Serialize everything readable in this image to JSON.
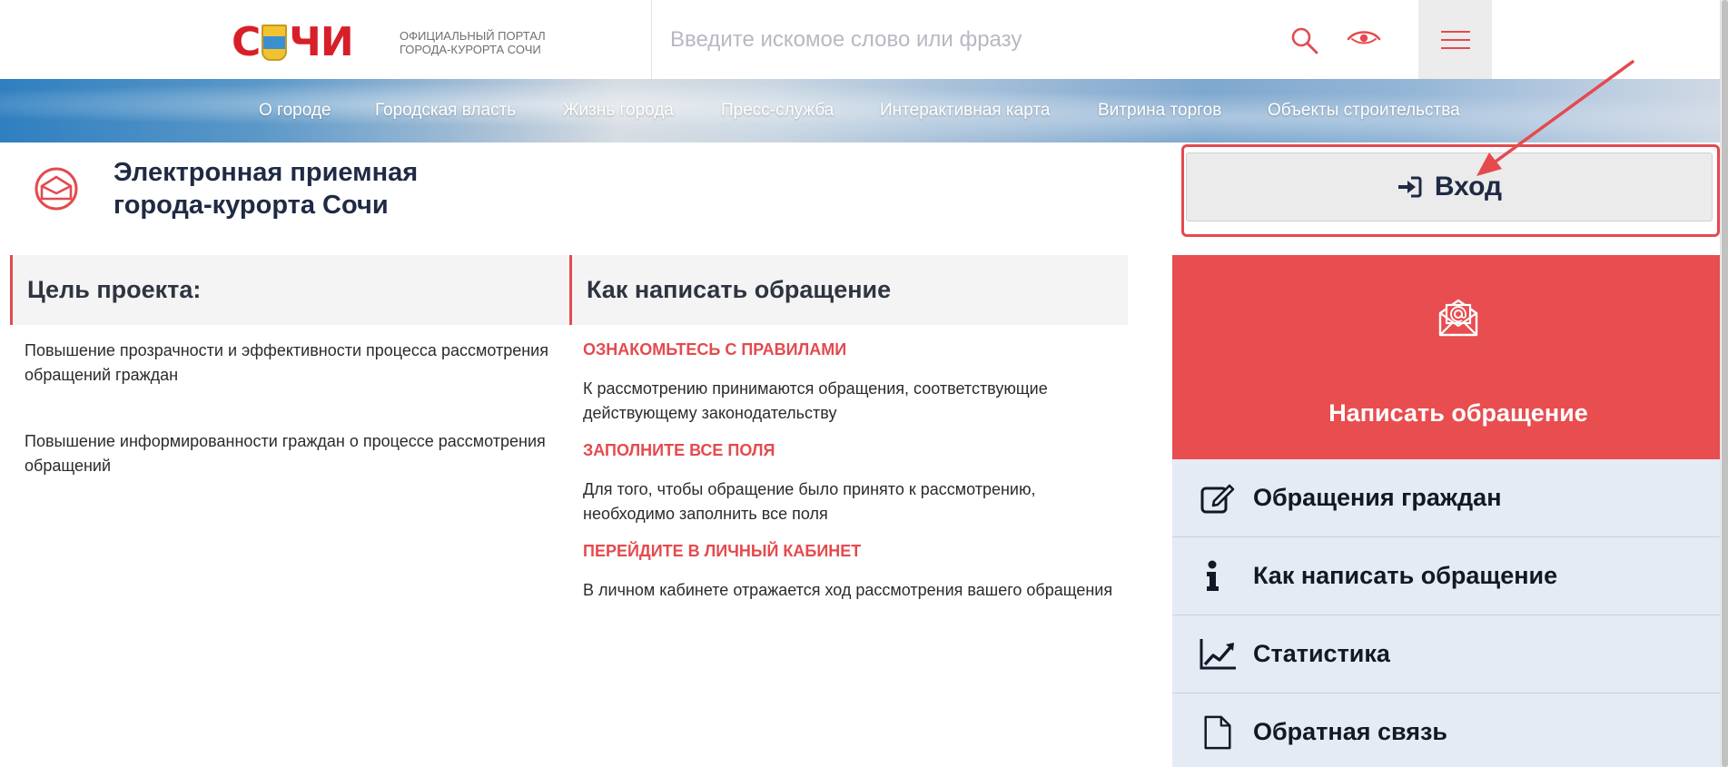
{
  "header": {
    "logo_text_left": "С",
    "logo_text_right": "ЧИ",
    "portal_caption_line1": "ОФИЦИАЛЬНЫЙ ПОРТАЛ",
    "portal_caption_line2": "ГОРОДА-КУРОРТА СОЧИ",
    "search_placeholder": "Введите искомое слово или фразу",
    "icons": [
      "search-icon",
      "eye-icon",
      "hamburger-menu-icon"
    ]
  },
  "nav": {
    "items": [
      {
        "label": "О городе"
      },
      {
        "label": "Городская власть"
      },
      {
        "label": "Жизнь города"
      },
      {
        "label": "Пресс-служба"
      },
      {
        "label": "Интерактивная карта"
      },
      {
        "label": "Витрина торгов"
      },
      {
        "label": "Объекты строительства"
      }
    ]
  },
  "reception": {
    "title_line1": "Электронная приемная",
    "title_line2": "города-курорта Сочи",
    "icon": "reception-envelope-icon"
  },
  "login": {
    "label": "Вход",
    "icon": "sign-in-icon"
  },
  "goal": {
    "heading": "Цель проекта:",
    "items": [
      {
        "line1": "Повышение прозрачности и эффективности процесса рассмотрения",
        "line2": "обращений граждан"
      },
      {
        "line1": "Повышение информированности граждан о процессе рассмотрения",
        "line2": "обращений"
      }
    ]
  },
  "how": {
    "heading": "Как написать обращение",
    "steps": [
      {
        "title": "ОЗНАКОМЬТЕСЬ С ПРАВИЛАМИ",
        "line1": "К рассмотрению принимаются обращения, соответствующие",
        "line2": "действующему законодательству"
      },
      {
        "title": "ЗАПОЛНИТЕ ВСЕ ПОЛЯ",
        "line1": "Для того, чтобы обращение было принято к рассмотрению,",
        "line2": "необходимо заполнить все поля"
      },
      {
        "title": "ПЕРЕЙДИТЕ В ЛИЧНЫЙ КАБИНЕТ",
        "line1": "В личном кабинете отражается ход рассмотрения вашего обращения",
        "line2": ""
      }
    ]
  },
  "sidebar": {
    "write": {
      "label": "Написать обращение",
      "icon": "mail-at-icon"
    },
    "items": [
      {
        "label": "Обращения граждан",
        "icon": "edit-icon"
      },
      {
        "label": "Как написать обращение",
        "icon": "info-icon"
      },
      {
        "label": "Статистика",
        "icon": "chart-line-icon"
      },
      {
        "label": "Обратная связь",
        "icon": "document-icon"
      }
    ]
  },
  "colors": {
    "accent_red": "#e44a4e",
    "write_card_bg": "#e84d4f",
    "menu_row_bg": "#e4ebf4",
    "title_navy": "#1f2a44"
  }
}
